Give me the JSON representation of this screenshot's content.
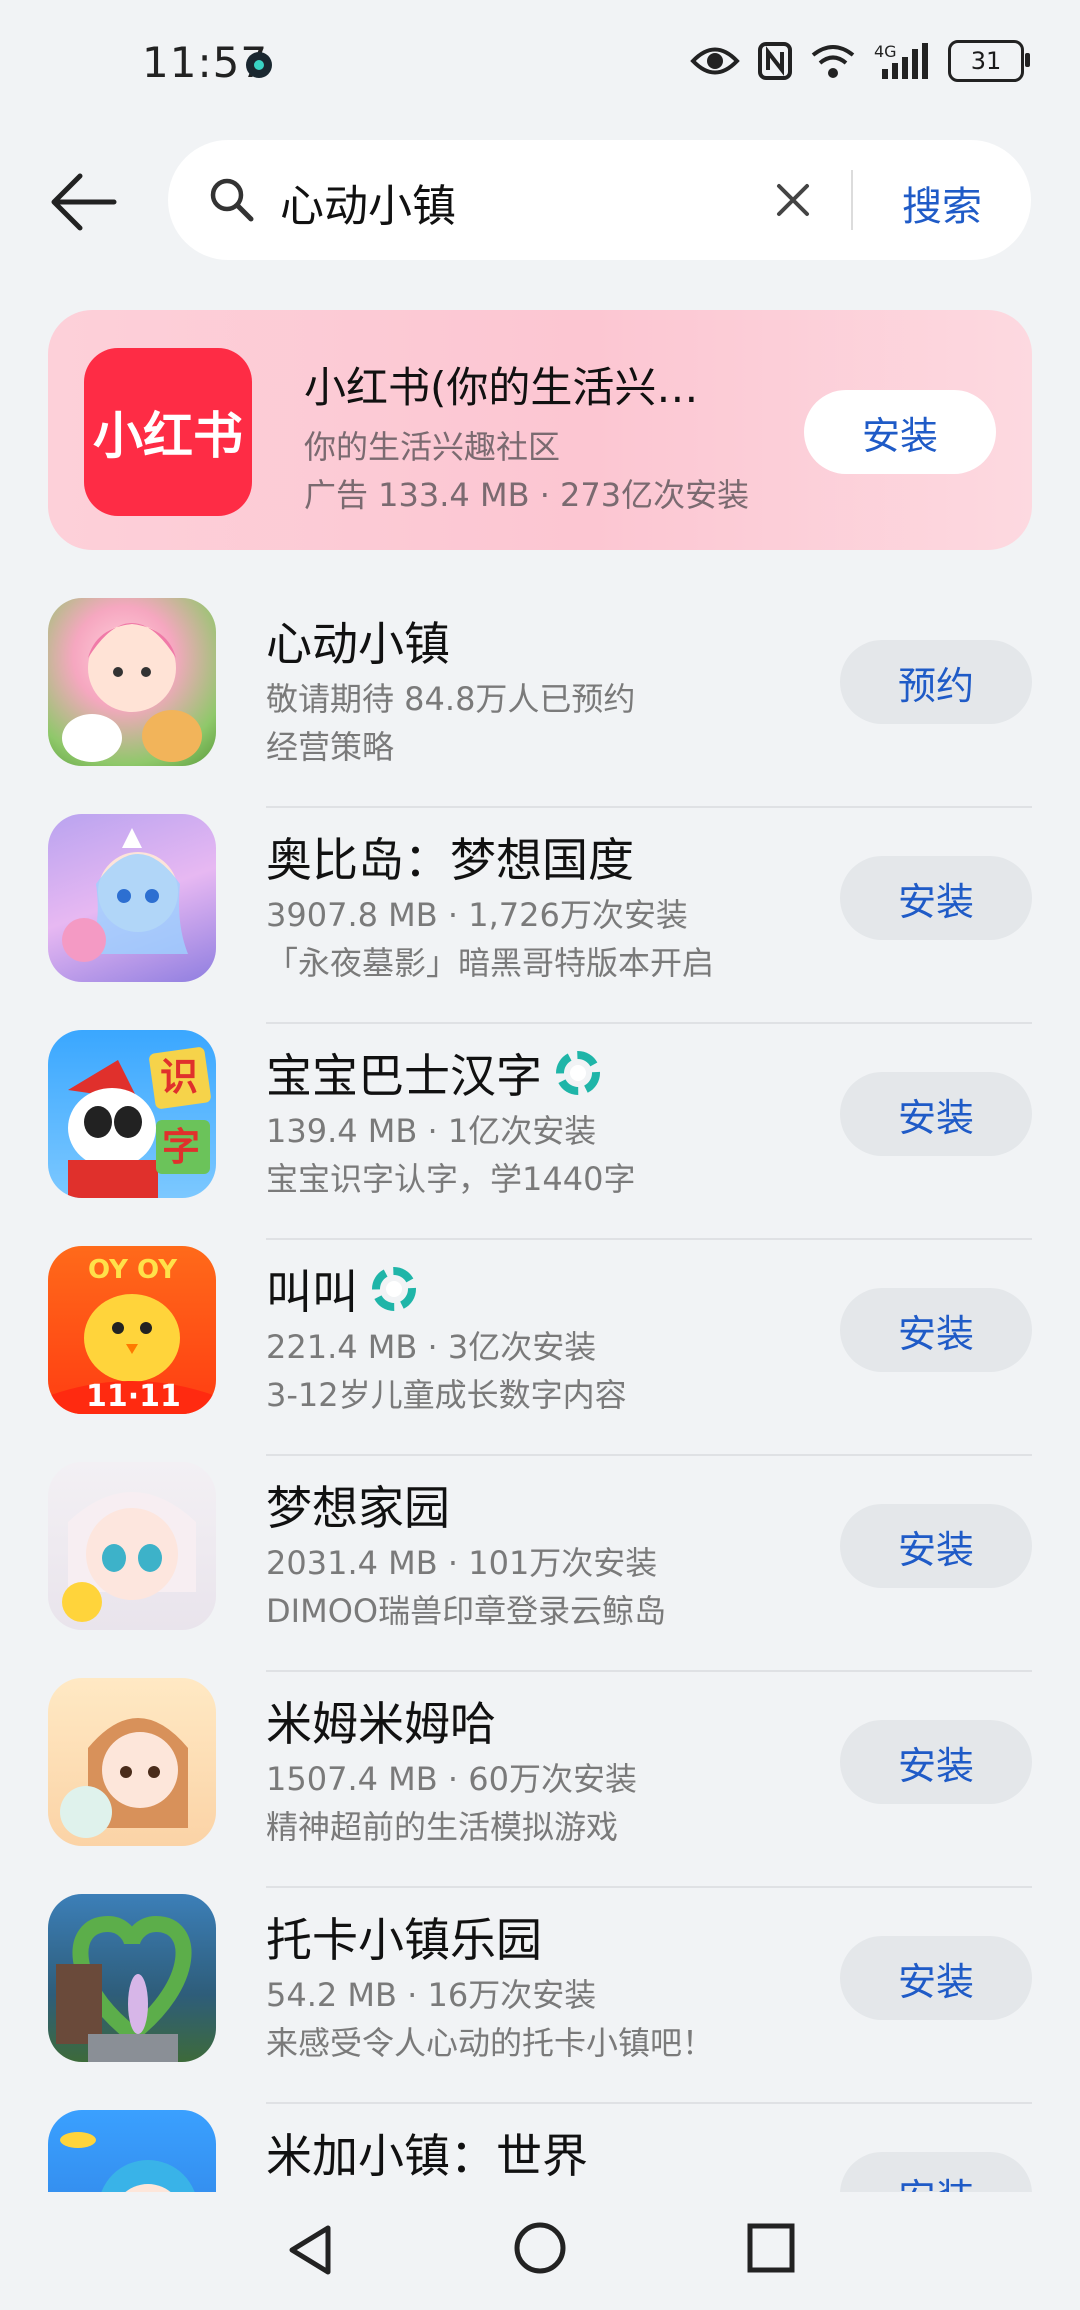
{
  "status_bar": {
    "time": "11:57",
    "battery": "31"
  },
  "search": {
    "query": "心动小镇",
    "submit_label": "搜索"
  },
  "ad": {
    "icon_text": "小红书",
    "title": "小红书(你的生活兴…",
    "subtitle": "你的生活兴趣社区",
    "meta": "广告 133.4 MB · 273亿次安装",
    "button": "安装",
    "colors": {
      "icon_bg": "#fe2c45",
      "card_bg": "#fcc6d2"
    }
  },
  "results": [
    {
      "name": "心动小镇",
      "line1": "敬请期待 84.8万人已预约",
      "line2": "经营策略",
      "button": "预约",
      "verified": false
    },
    {
      "name": "奥比岛：梦想国度",
      "line1": "3907.8 MB · 1,726万次安装",
      "line2": "「永夜墓影」暗黑哥特版本开启",
      "button": "安装",
      "verified": false
    },
    {
      "name": "宝宝巴士汉字",
      "line1": "139.4 MB · 1亿次安装",
      "line2": "宝宝识字认字，学1440字",
      "button": "安装",
      "verified": true
    },
    {
      "name": "叫叫",
      "line1": "221.4 MB · 3亿次安装",
      "line2": "3-12岁儿童成长数字内容",
      "button": "安装",
      "verified": true
    },
    {
      "name": "梦想家园",
      "line1": "2031.4 MB · 101万次安装",
      "line2": "DIMOO瑞兽印章登录云鲸岛",
      "button": "安装",
      "verified": false
    },
    {
      "name": "米姆米姆哈",
      "line1": "1507.4 MB · 60万次安装",
      "line2": "精神超前的生活模拟游戏",
      "button": "安装",
      "verified": false
    },
    {
      "name": "托卡小镇乐园",
      "line1": "54.2 MB · 16万次安装",
      "line2": "来感受令人心动的托卡小镇吧！",
      "button": "安装",
      "verified": false
    },
    {
      "name": "米加小镇：世界",
      "line1": "",
      "line2": "",
      "button": "安装",
      "verified": false
    }
  ],
  "icons": {
    "back": "arrow-left-icon",
    "search": "search-icon",
    "clear": "close-icon",
    "verified": "verified-badge-icon",
    "nav": [
      "nav-back-icon",
      "nav-home-icon",
      "nav-recent-icon"
    ]
  },
  "colors": {
    "accent": "#1f5bc7",
    "background": "#f1f3f5",
    "button_bg": "#e4e7ea"
  }
}
